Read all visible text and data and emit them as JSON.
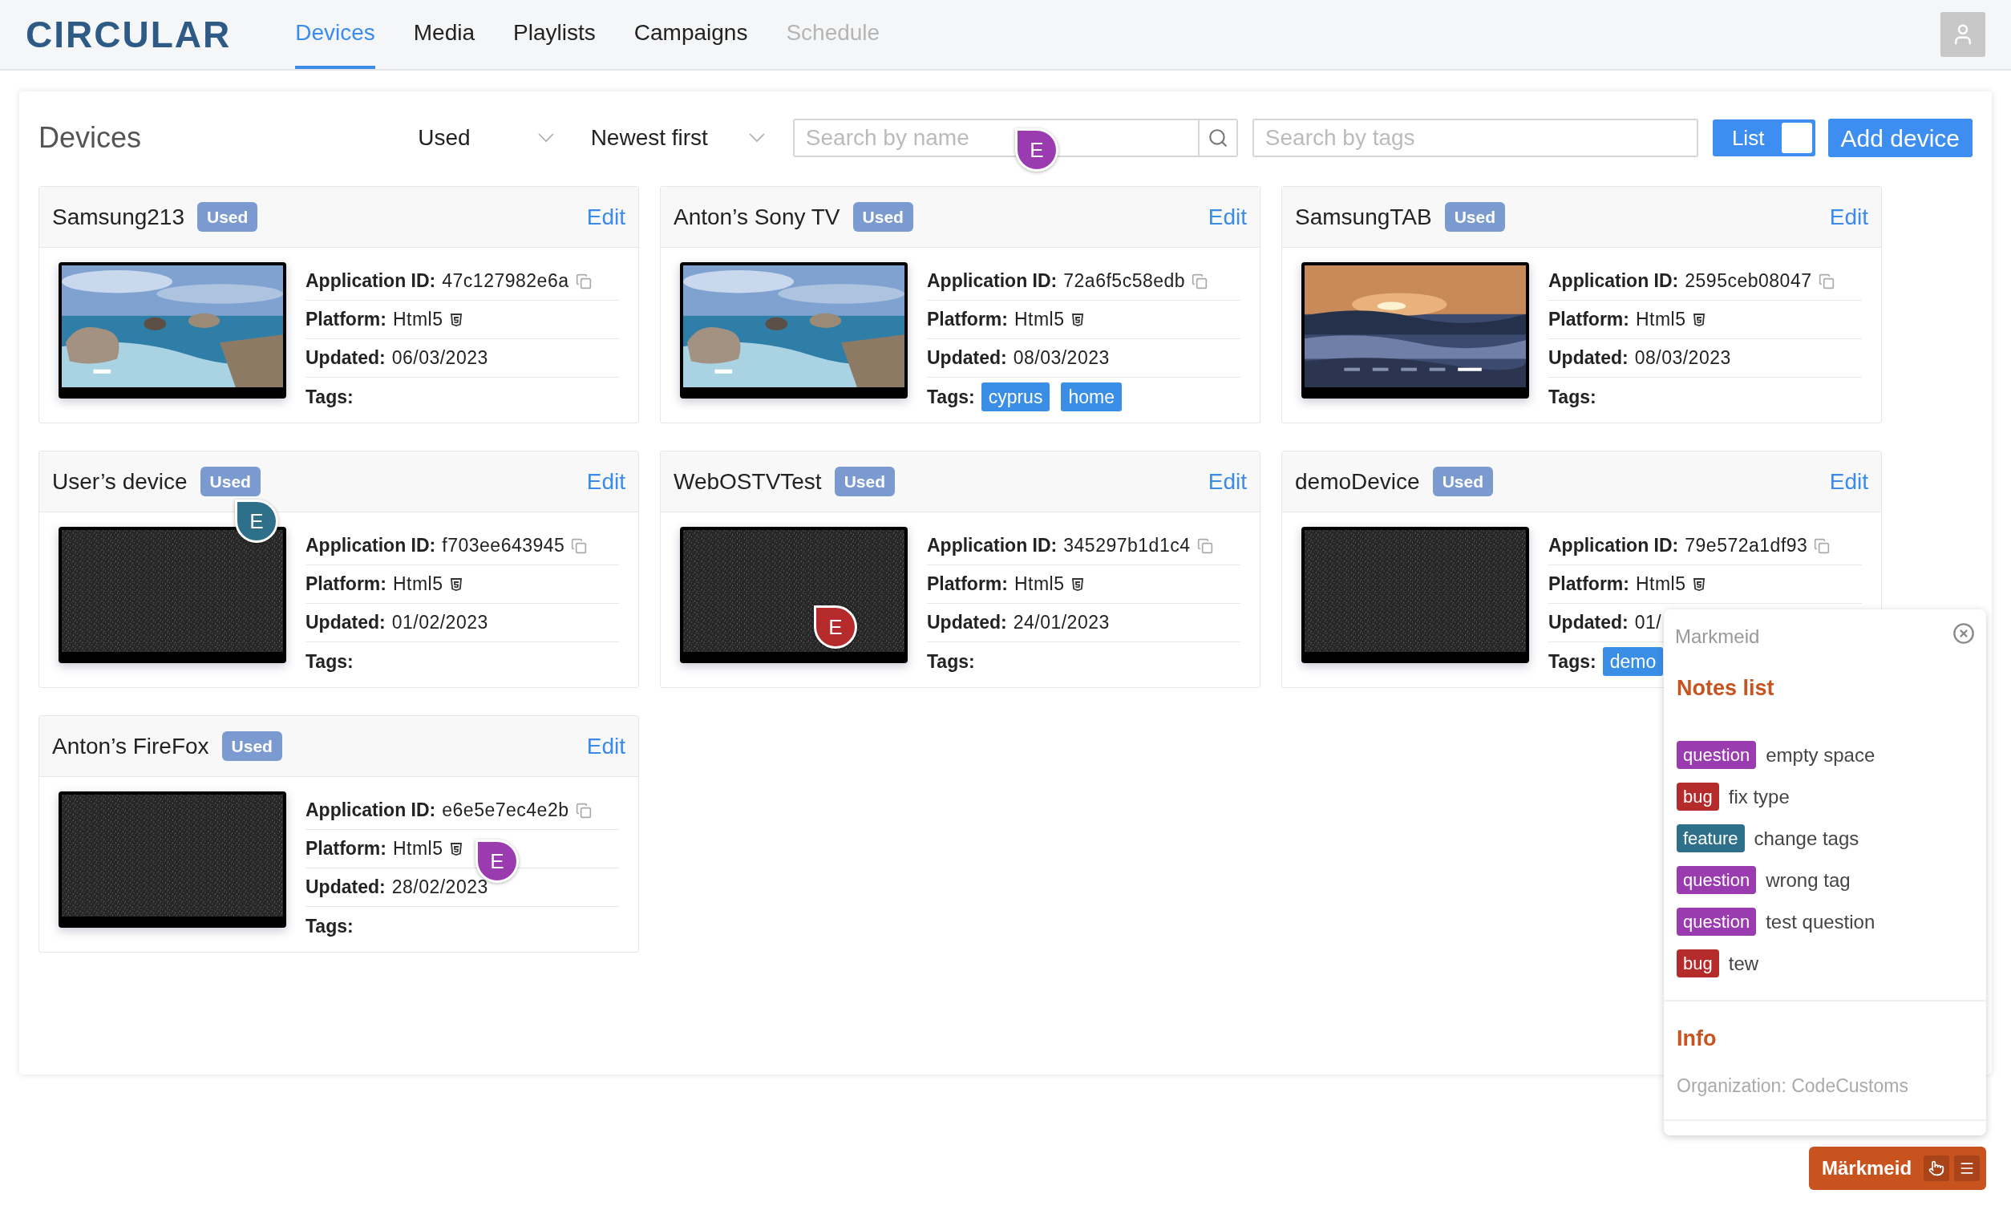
{
  "header": {
    "logo": "CIRCULAR",
    "nav": [
      {
        "label": "Devices",
        "selected": true,
        "disabled": false
      },
      {
        "label": "Media",
        "selected": false,
        "disabled": false
      },
      {
        "label": "Playlists",
        "selected": false,
        "disabled": false
      },
      {
        "label": "Campaigns",
        "selected": false,
        "disabled": false
      },
      {
        "label": "Schedule",
        "selected": false,
        "disabled": true
      }
    ]
  },
  "toolbar": {
    "title": "Devices",
    "filter": "Used",
    "sort": "Newest first",
    "search_name": {
      "placeholder": "Search by name"
    },
    "search_tags": {
      "placeholder": "Search by tags"
    },
    "view_toggle": {
      "label": "List",
      "on": false
    },
    "add_button": "Add device"
  },
  "devices": [
    {
      "name": "Samsung213",
      "badge": "Used",
      "edit": "Edit",
      "screen": {
        "kind": "picture"
      },
      "fields": [
        {
          "kind": "id",
          "label": "Application ID:",
          "value": "47c127982e6a"
        },
        {
          "kind": "platform",
          "label": "Platform:",
          "value": "Html5"
        },
        {
          "kind": "date",
          "label": "Updated:",
          "value": "06/03/2023"
        },
        {
          "kind": "tags",
          "label": "Tags:"
        }
      ]
    },
    {
      "name": "Anton’s Sony TV",
      "badge": "Used",
      "edit": "Edit",
      "screen": {
        "kind": "picture"
      },
      "fields": [
        {
          "kind": "id",
          "label": "Application ID:",
          "value": "72a6f5c58edb"
        },
        {
          "kind": "platform",
          "label": "Platform:",
          "value": "Html5"
        },
        {
          "kind": "date",
          "label": "Updated:",
          "value": "08/03/2023"
        },
        {
          "kind": "tags",
          "label": "Tags:",
          "tags": [
            "cyprus",
            "home"
          ]
        }
      ]
    },
    {
      "name": "SamsungTAB",
      "badge": "Used",
      "edit": "Edit",
      "screen": {
        "kind": "picture"
      },
      "fields": [
        {
          "kind": "id",
          "label": "Application ID:",
          "value": "2595ceb08047"
        },
        {
          "kind": "platform",
          "label": "Platform:",
          "value": "Html5"
        },
        {
          "kind": "date",
          "label": "Updated:",
          "value": "08/03/2023"
        },
        {
          "kind": "tags",
          "label": "Tags:"
        }
      ]
    },
    {
      "name": "User’s device",
      "badge": "Used",
      "edit": "Edit",
      "screen": {
        "kind": "static"
      },
      "fields": [
        {
          "kind": "id",
          "label": "Application ID:",
          "value": "f703ee643945"
        },
        {
          "kind": "platform",
          "label": "Platform:",
          "value": "Html5"
        },
        {
          "kind": "date",
          "label": "Updated:",
          "value": "01/02/2023"
        },
        {
          "kind": "tags",
          "label": "Tags:"
        }
      ]
    },
    {
      "name": "WebOSTVTest",
      "badge": "Used",
      "edit": "Edit",
      "screen": {
        "kind": "static"
      },
      "fields": [
        {
          "kind": "id",
          "label": "Application ID:",
          "value": "345297b1d1c4"
        },
        {
          "kind": "platform",
          "label": "Platform:",
          "value": "Html5"
        },
        {
          "kind": "date",
          "label": "Updated:",
          "value": "24/01/2023"
        },
        {
          "kind": "tags",
          "label": "Tags:"
        }
      ]
    },
    {
      "name": "demoDevice",
      "badge": "Used",
      "edit": "Edit",
      "screen": {
        "kind": "static"
      },
      "fields": [
        {
          "kind": "id",
          "label": "Application ID:",
          "value": "79e572a1df93"
        },
        {
          "kind": "platform",
          "label": "Platform:",
          "value": "Html5"
        },
        {
          "kind": "date",
          "label": "Updated:",
          "value": "01/"
        },
        {
          "kind": "tags",
          "label": "Tags:",
          "tags": [
            "demo"
          ]
        }
      ]
    },
    {
      "name": "Anton’s FireFox",
      "badge": "Used",
      "edit": "Edit",
      "screen": {
        "kind": "static"
      },
      "fields": [
        {
          "kind": "id",
          "label": "Application ID:",
          "value": "e6e5e7ec4e2b"
        },
        {
          "kind": "platform",
          "label": "Platform:",
          "value": "Html5"
        },
        {
          "kind": "date",
          "label": "Updated:",
          "value": "28/02/2023"
        },
        {
          "kind": "tags",
          "label": "Tags:"
        }
      ]
    }
  ],
  "markers": [
    {
      "label": "E",
      "color": "#9b3bb0"
    },
    {
      "label": "E",
      "color": "#2e6f8a"
    },
    {
      "label": "E",
      "color": "#b52a2a"
    },
    {
      "label": "E",
      "color": "#9b3bb0"
    }
  ],
  "notes_panel": {
    "title": "Markmeid",
    "notes_heading": "Notes list",
    "notes": [
      {
        "tag": "question",
        "color": "#9b3bb0",
        "text": "empty space"
      },
      {
        "tag": "bug",
        "color": "#b52a2a",
        "text": "fix type"
      },
      {
        "tag": "feature",
        "color": "#2e6f8a",
        "text": "change tags"
      },
      {
        "tag": "question",
        "color": "#9b3bb0",
        "text": "wrong tag"
      },
      {
        "tag": "question",
        "color": "#9b3bb0",
        "text": "test question"
      },
      {
        "tag": "bug",
        "color": "#b52a2a",
        "text": "tew"
      }
    ],
    "info_heading": "Info",
    "organization": "Organization: CodeCustoms"
  },
  "markmeid_button": "Märkmeid"
}
